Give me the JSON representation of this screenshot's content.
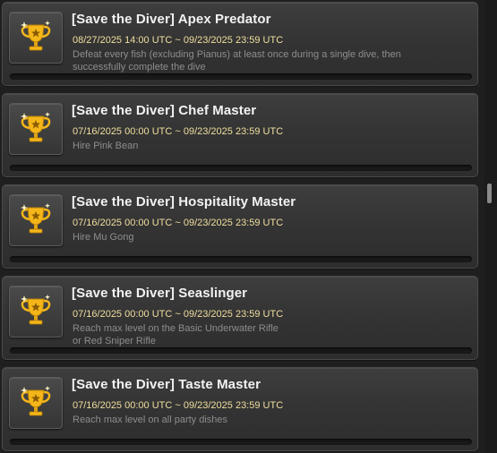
{
  "achievements": [
    {
      "icon": "trophy-icon",
      "title": "[Save the Diver] Apex Predator",
      "period": "08/27/2025 14:00 UTC ~ 09/23/2025 23:59 UTC",
      "description_lines": [
        "Defeat every fish (excluding Pianus) at least once during a single dive, then",
        "successfully complete the dive"
      ],
      "progress": 0
    },
    {
      "icon": "trophy-icon",
      "title": "[Save the Diver] Chef Master",
      "period": "07/16/2025 00:00 UTC ~ 09/23/2025 23:59 UTC",
      "description_lines": [
        "Hire Pink Bean"
      ],
      "progress": 0
    },
    {
      "icon": "trophy-icon",
      "title": "[Save the Diver] Hospitality Master",
      "period": "07/16/2025 00:00 UTC ~ 09/23/2025 23:59 UTC",
      "description_lines": [
        "Hire Mu Gong"
      ],
      "progress": 0
    },
    {
      "icon": "trophy-icon",
      "title": "[Save the Diver] Seaslinger",
      "period": "07/16/2025 00:00 UTC ~ 09/23/2025 23:59 UTC",
      "description_lines": [
        "Reach max level on the Basic Underwater Rifle",
        "or Red Sniper Rifle"
      ],
      "progress": 0
    },
    {
      "icon": "trophy-icon",
      "title": "[Save the Diver] Taste Master",
      "period": "07/16/2025 00:00 UTC ~ 09/23/2025 23:59 UTC",
      "description_lines": [
        "Reach max level on all party dishes"
      ],
      "progress": 0
    }
  ],
  "colors": {
    "title": "#f2f2f2",
    "period": "#f1dfa0",
    "description": "#8d8d8d",
    "trophy_gold": "#f5b61a"
  }
}
